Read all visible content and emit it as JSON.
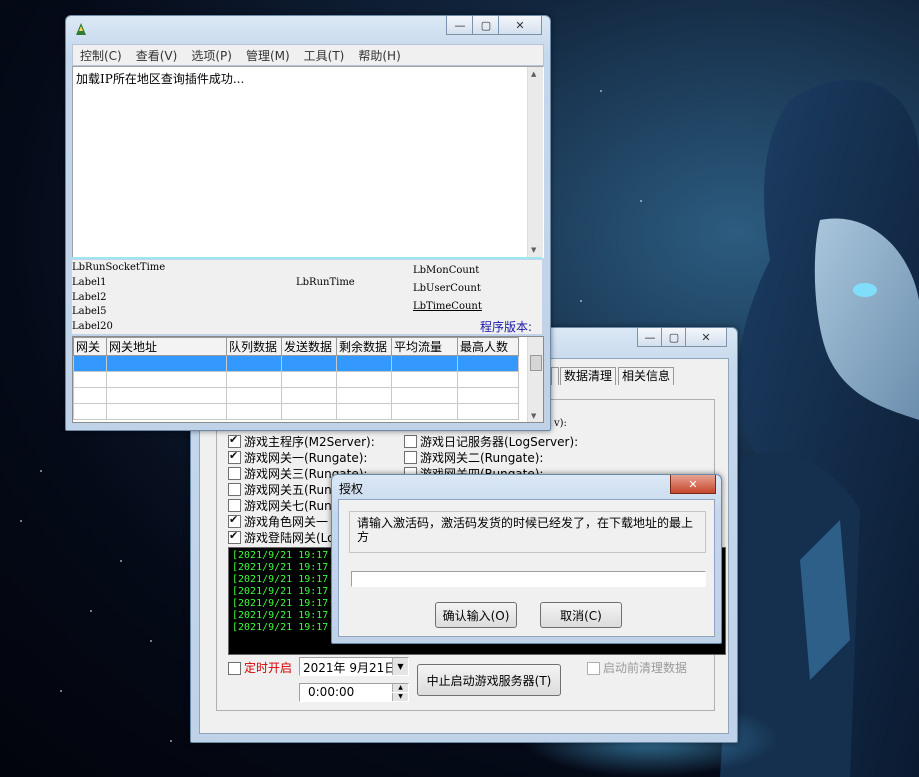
{
  "main_window": {
    "menu": [
      "控制(C)",
      "查看(V)",
      "选项(P)",
      "管理(M)",
      "工具(T)",
      "帮助(H)"
    ],
    "log_text": "加载IP所在地区查询插件成功...",
    "labels": {
      "run_socket_time": "LbRunSocketTime",
      "label1": "Label1",
      "label2": "Label2",
      "label5": "Label5",
      "label20": "Label20",
      "run_time": "LbRunTime",
      "mon_count": "LbMonCount",
      "user_count": "LbUserCount",
      "time_count": "LbTimeCount",
      "version": "程序版本:"
    },
    "table_headers": [
      "网关",
      "网关地址",
      "队列数据",
      "发送数据",
      "剩余数据",
      "平均流量",
      "最高人数"
    ]
  },
  "launcher_window": {
    "tabs": [
      "数据清理",
      "相关信息"
    ],
    "partial_v": "v):",
    "checks_left": [
      {
        "label": "游戏主程序(M2Server):",
        "checked": true
      },
      {
        "label": "游戏网关一(Rungate):",
        "checked": true
      },
      {
        "label": "游戏网关三(Rungate):",
        "checked": false
      },
      {
        "label": "游戏网关五(Rung",
        "checked": false
      },
      {
        "label": "游戏网关七(Rung",
        "checked": false
      },
      {
        "label": "游戏角色网关一",
        "checked": true
      },
      {
        "label": "游戏登陆网关(Lo",
        "checked": true
      }
    ],
    "checks_right": [
      {
        "label": "游戏日记服务器(LogServer):",
        "checked": false
      },
      {
        "label": "游戏网关二(Rungate):",
        "checked": false
      },
      {
        "label": "游戏网关四(Rungate):",
        "checked": false
      }
    ],
    "log_lines": [
      "[2021/9/21 19:17:",
      "[2021/9/21 19:17:",
      "[2021/9/21 19:17:",
      "[2021/9/21 19:17:",
      "[2021/9/21 19:17:",
      "[2021/9/21 19:17:",
      "[2021/9/21 19:17:"
    ],
    "timer_label": "定时开启",
    "date_value": "2021年  9月21日",
    "time_value": "0:00:00",
    "stop_button": "中止启动游戏服务器(T)",
    "clean_label": "启动前清理数据"
  },
  "dialog": {
    "title": "授权",
    "message": "请输入激活码，激活码发货的时候已经发了，在下载地址的最上方",
    "input_value": "",
    "confirm_button": "确认输入(O)",
    "cancel_button": "取消(C)"
  }
}
